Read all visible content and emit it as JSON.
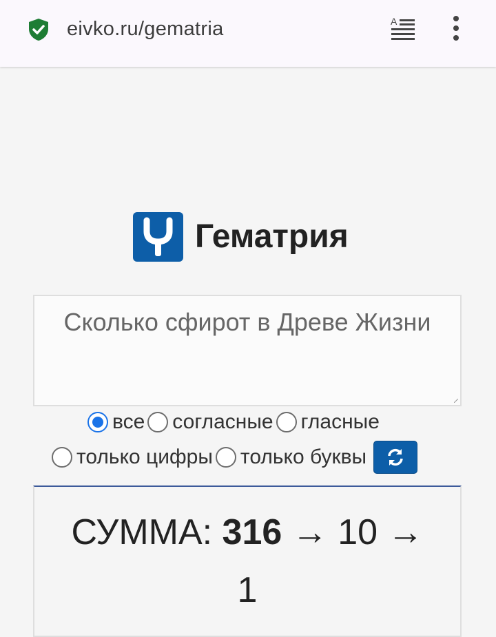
{
  "browser": {
    "url": "eivko.ru/gematria",
    "secure_icon": "shield-check-icon",
    "reader_icon": "reader-mode-icon",
    "menu_icon": "more-vert-icon"
  },
  "header": {
    "logo_icon": "y-logo-icon",
    "title": "Гематрия"
  },
  "input": {
    "value": "Сколько сфирот в Древе Жизни"
  },
  "options": {
    "all": "все",
    "consonants": "согласные",
    "vowels": "гласные",
    "digits_only": "только цифры",
    "letters_only": "только буквы",
    "selected": "все",
    "refresh_icon": "refresh-icon"
  },
  "result": {
    "label": "СУММА:",
    "sum": "316",
    "arrow1": "→",
    "step1": "10",
    "arrow2": "→",
    "step2": "1"
  },
  "colors": {
    "brand": "#0d5ea8",
    "radio_selected": "#1a73e8",
    "shield": "#1e7d34"
  }
}
